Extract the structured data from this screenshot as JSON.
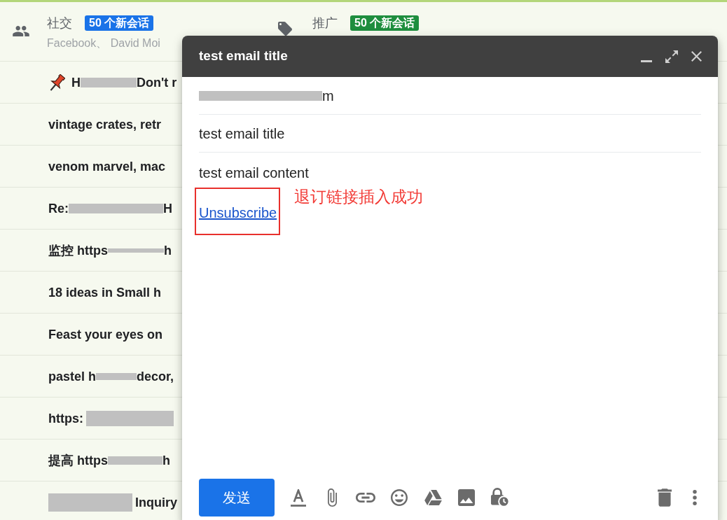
{
  "categories": [
    {
      "kind": "social",
      "title": "社交",
      "badge": "50 个新会话",
      "color": "#1a73e8",
      "subtitle": "Facebook、 David Moi"
    },
    {
      "kind": "promotions",
      "title": "推广",
      "badge": "50 个新会话",
      "color": "#1e8e3e"
    }
  ],
  "messages": [
    {
      "pinned": true,
      "subject": [
        {
          "kind": "text",
          "text": "H"
        },
        {
          "kind": "redaction"
        },
        {
          "kind": "text",
          "text": "Don't r"
        }
      ]
    },
    {
      "pinned": false,
      "subject": [
        {
          "kind": "text",
          "text": "vintage crates, retr"
        }
      ]
    },
    {
      "pinned": false,
      "subject": [
        {
          "kind": "text",
          "text": "venom marvel, mac"
        }
      ]
    },
    {
      "pinned": false,
      "subject": [
        {
          "kind": "text",
          "text": "Re:"
        },
        {
          "kind": "redaction"
        },
        {
          "kind": "text",
          "text": "H"
        }
      ]
    },
    {
      "pinned": false,
      "subject": [
        {
          "kind": "text",
          "text": "监控 https"
        },
        {
          "kind": "redaction"
        },
        {
          "kind": "text",
          "text": "h"
        }
      ]
    },
    {
      "pinned": false,
      "subject": [
        {
          "kind": "text",
          "text": "18 ideas in Small h"
        }
      ]
    },
    {
      "pinned": false,
      "subject": [
        {
          "kind": "text",
          "text": "Feast your eyes on"
        }
      ]
    },
    {
      "pinned": false,
      "subject": [
        {
          "kind": "text",
          "text": "pastel h"
        },
        {
          "kind": "redaction"
        },
        {
          "kind": "text",
          "text": "decor,"
        }
      ]
    },
    {
      "pinned": false,
      "subject": [
        {
          "kind": "text",
          "text": "https:"
        },
        {
          "kind": "redaction"
        }
      ]
    },
    {
      "pinned": false,
      "subject": [
        {
          "kind": "text",
          "text": "提高 https"
        },
        {
          "kind": "redaction"
        },
        {
          "kind": "text",
          "text": "h"
        }
      ]
    },
    {
      "pinned": false,
      "subject": [
        {
          "kind": "redaction"
        },
        {
          "kind": "text",
          "text": "Inquiry"
        }
      ]
    }
  ],
  "compose": {
    "title": "test email title",
    "to": [
      {
        "kind": "redaction"
      },
      {
        "kind": "text",
        "text": "m"
      }
    ],
    "subject": "test email title",
    "body": "test email content",
    "link": "Unsubscribe",
    "annotation": "退订链接插入成功",
    "send_button": "发送"
  }
}
